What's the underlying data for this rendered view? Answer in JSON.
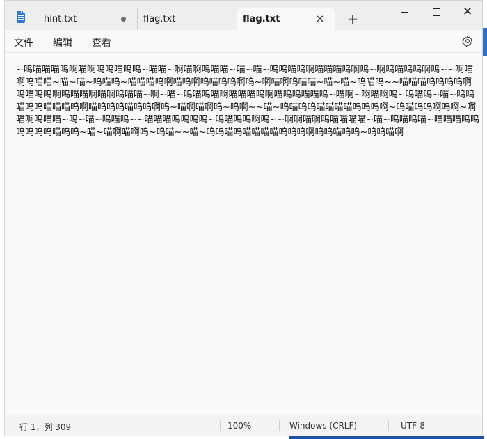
{
  "tabs": [
    {
      "label": "hint.txt",
      "modified": true
    },
    {
      "label": "flag.txt"
    },
    {
      "label": "flag.txt",
      "active": true
    }
  ],
  "window_controls": {
    "minimize": "—",
    "maximize": "☐",
    "close": "✕"
  },
  "new_tab_label": "+",
  "menu": {
    "file": "文件",
    "edit": "编辑",
    "view": "查看"
  },
  "editor": {
    "content": "~呜喵喵喵呜啊喵啊呜呜喵呜呜~喵喵~啊喵啊呜喵喵~喵~喵~呜呜喵呜啊喵喵喵呜啊呜~啊呜喵呜呜啊呜~~啊喵啊呜喵喵~喵~喵~呜喵呜~喵喵喵呜啊喵呜啊呜喵呜呜啊呜~啊喵啊呜喵喵~喵~喵~呜喵呜~~喵喵喵呜呜呜呜啊呜喵呜呜啊呜喵喵啊喵啊呜喵喵~啊~喵~呜喵呜喵啊喵喵喵呜啊喵呜呜喵喵呜~喵啊~啊喵啊呜~呜喵呜~喵~呜呜喵呜呜喵喵喵呜啊喵呜呜呜喵呜呜啊呜~喵啊喵啊呜~呜啊~~喵~呜喵呜呜喵喵喵喵呜呜呜啊~呜喵呜呜啊呜啊~啊喵啊呜喵喵~呜~喵~呜喵呜~~喵喵喵呜呜呜呜~呜喵呜呜啊呜~~啊啊喵啊呜喵喵喵喵~喵~呜喵呜喵~喵喵喵呜呜呜呜呜呜喵呜呜~喵~喵啊喵啊呜~呜喵~~喵~呜呜喵呜喵喵喵喵呜呜呜啊呜呜喵呜呜~呜呜喵啊"
  },
  "status": {
    "position": "行 1，列 309",
    "zoom": "100%",
    "line_ending": "Windows (CRLF)",
    "encoding": "UTF-8"
  },
  "colors": {
    "accent": "#2b7bd6",
    "window_bg": "#f9f9f9",
    "titlebar_bg": "#eeeeee"
  }
}
